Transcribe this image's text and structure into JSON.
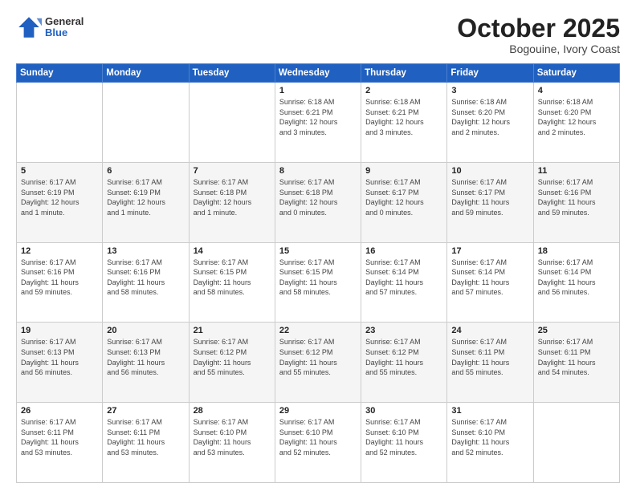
{
  "header": {
    "logo_general": "General",
    "logo_blue": "Blue",
    "title": "October 2025",
    "subtitle": "Bogouine, Ivory Coast"
  },
  "days_of_week": [
    "Sunday",
    "Monday",
    "Tuesday",
    "Wednesday",
    "Thursday",
    "Friday",
    "Saturday"
  ],
  "weeks": [
    [
      {
        "day": "",
        "info": ""
      },
      {
        "day": "",
        "info": ""
      },
      {
        "day": "",
        "info": ""
      },
      {
        "day": "1",
        "info": "Sunrise: 6:18 AM\nSunset: 6:21 PM\nDaylight: 12 hours\nand 3 minutes."
      },
      {
        "day": "2",
        "info": "Sunrise: 6:18 AM\nSunset: 6:21 PM\nDaylight: 12 hours\nand 3 minutes."
      },
      {
        "day": "3",
        "info": "Sunrise: 6:18 AM\nSunset: 6:20 PM\nDaylight: 12 hours\nand 2 minutes."
      },
      {
        "day": "4",
        "info": "Sunrise: 6:18 AM\nSunset: 6:20 PM\nDaylight: 12 hours\nand 2 minutes."
      }
    ],
    [
      {
        "day": "5",
        "info": "Sunrise: 6:17 AM\nSunset: 6:19 PM\nDaylight: 12 hours\nand 1 minute."
      },
      {
        "day": "6",
        "info": "Sunrise: 6:17 AM\nSunset: 6:19 PM\nDaylight: 12 hours\nand 1 minute."
      },
      {
        "day": "7",
        "info": "Sunrise: 6:17 AM\nSunset: 6:18 PM\nDaylight: 12 hours\nand 1 minute."
      },
      {
        "day": "8",
        "info": "Sunrise: 6:17 AM\nSunset: 6:18 PM\nDaylight: 12 hours\nand 0 minutes."
      },
      {
        "day": "9",
        "info": "Sunrise: 6:17 AM\nSunset: 6:17 PM\nDaylight: 12 hours\nand 0 minutes."
      },
      {
        "day": "10",
        "info": "Sunrise: 6:17 AM\nSunset: 6:17 PM\nDaylight: 11 hours\nand 59 minutes."
      },
      {
        "day": "11",
        "info": "Sunrise: 6:17 AM\nSunset: 6:16 PM\nDaylight: 11 hours\nand 59 minutes."
      }
    ],
    [
      {
        "day": "12",
        "info": "Sunrise: 6:17 AM\nSunset: 6:16 PM\nDaylight: 11 hours\nand 59 minutes."
      },
      {
        "day": "13",
        "info": "Sunrise: 6:17 AM\nSunset: 6:16 PM\nDaylight: 11 hours\nand 58 minutes."
      },
      {
        "day": "14",
        "info": "Sunrise: 6:17 AM\nSunset: 6:15 PM\nDaylight: 11 hours\nand 58 minutes."
      },
      {
        "day": "15",
        "info": "Sunrise: 6:17 AM\nSunset: 6:15 PM\nDaylight: 11 hours\nand 58 minutes."
      },
      {
        "day": "16",
        "info": "Sunrise: 6:17 AM\nSunset: 6:14 PM\nDaylight: 11 hours\nand 57 minutes."
      },
      {
        "day": "17",
        "info": "Sunrise: 6:17 AM\nSunset: 6:14 PM\nDaylight: 11 hours\nand 57 minutes."
      },
      {
        "day": "18",
        "info": "Sunrise: 6:17 AM\nSunset: 6:14 PM\nDaylight: 11 hours\nand 56 minutes."
      }
    ],
    [
      {
        "day": "19",
        "info": "Sunrise: 6:17 AM\nSunset: 6:13 PM\nDaylight: 11 hours\nand 56 minutes."
      },
      {
        "day": "20",
        "info": "Sunrise: 6:17 AM\nSunset: 6:13 PM\nDaylight: 11 hours\nand 56 minutes."
      },
      {
        "day": "21",
        "info": "Sunrise: 6:17 AM\nSunset: 6:12 PM\nDaylight: 11 hours\nand 55 minutes."
      },
      {
        "day": "22",
        "info": "Sunrise: 6:17 AM\nSunset: 6:12 PM\nDaylight: 11 hours\nand 55 minutes."
      },
      {
        "day": "23",
        "info": "Sunrise: 6:17 AM\nSunset: 6:12 PM\nDaylight: 11 hours\nand 55 minutes."
      },
      {
        "day": "24",
        "info": "Sunrise: 6:17 AM\nSunset: 6:11 PM\nDaylight: 11 hours\nand 55 minutes."
      },
      {
        "day": "25",
        "info": "Sunrise: 6:17 AM\nSunset: 6:11 PM\nDaylight: 11 hours\nand 54 minutes."
      }
    ],
    [
      {
        "day": "26",
        "info": "Sunrise: 6:17 AM\nSunset: 6:11 PM\nDaylight: 11 hours\nand 53 minutes."
      },
      {
        "day": "27",
        "info": "Sunrise: 6:17 AM\nSunset: 6:11 PM\nDaylight: 11 hours\nand 53 minutes."
      },
      {
        "day": "28",
        "info": "Sunrise: 6:17 AM\nSunset: 6:10 PM\nDaylight: 11 hours\nand 53 minutes."
      },
      {
        "day": "29",
        "info": "Sunrise: 6:17 AM\nSunset: 6:10 PM\nDaylight: 11 hours\nand 52 minutes."
      },
      {
        "day": "30",
        "info": "Sunrise: 6:17 AM\nSunset: 6:10 PM\nDaylight: 11 hours\nand 52 minutes."
      },
      {
        "day": "31",
        "info": "Sunrise: 6:17 AM\nSunset: 6:10 PM\nDaylight: 11 hours\nand 52 minutes."
      },
      {
        "day": "",
        "info": ""
      }
    ]
  ]
}
